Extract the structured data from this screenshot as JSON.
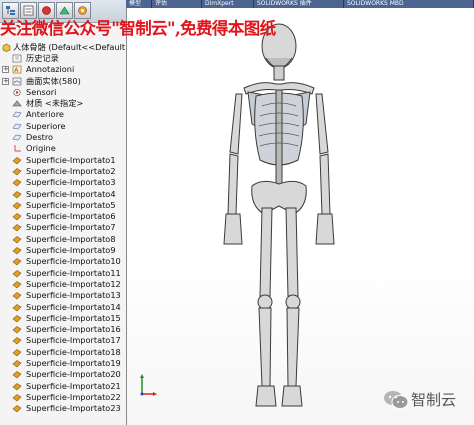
{
  "watermark": "关注微信公众号\"智制云\",免费得本图纸",
  "top_tabs": [
    "模型",
    "评估",
    "DimXpert",
    "SOLIDWORKS 插件",
    "SOLIDWORKS MBD"
  ],
  "tree": {
    "root": "人体骨骼  (Default<<Default",
    "items": [
      {
        "label": "历史记录",
        "icon": "history-icon",
        "expand": false
      },
      {
        "label": "Annotazioni",
        "icon": "annotation-icon",
        "expand": true
      },
      {
        "label": "曲面实体(580)",
        "icon": "surface-bodies-icon",
        "expand": true
      },
      {
        "label": "Sensori",
        "icon": "sensor-icon",
        "expand": false
      },
      {
        "label": "材质 <未指定>",
        "icon": "material-icon",
        "expand": false
      },
      {
        "label": "Anteriore",
        "icon": "plane-icon",
        "expand": false
      },
      {
        "label": "Superiore",
        "icon": "plane-icon",
        "expand": false
      },
      {
        "label": "Destro",
        "icon": "plane-icon",
        "expand": false
      },
      {
        "label": "Origine",
        "icon": "origin-icon",
        "expand": false
      },
      {
        "label": "Superficie-Importato1",
        "icon": "surface-icon",
        "expand": false
      },
      {
        "label": "Superficie-Importato2",
        "icon": "surface-icon",
        "expand": false
      },
      {
        "label": "Superficie-Importato3",
        "icon": "surface-icon",
        "expand": false
      },
      {
        "label": "Superficie-Importato4",
        "icon": "surface-icon",
        "expand": false
      },
      {
        "label": "Superficie-Importato5",
        "icon": "surface-icon",
        "expand": false
      },
      {
        "label": "Superficie-Importato6",
        "icon": "surface-icon",
        "expand": false
      },
      {
        "label": "Superficie-Importato7",
        "icon": "surface-icon",
        "expand": false
      },
      {
        "label": "Superficie-Importato8",
        "icon": "surface-icon",
        "expand": false
      },
      {
        "label": "Superficie-Importato9",
        "icon": "surface-icon",
        "expand": false
      },
      {
        "label": "Superficie-Importato10",
        "icon": "surface-icon",
        "expand": false
      },
      {
        "label": "Superficie-Importato11",
        "icon": "surface-icon",
        "expand": false
      },
      {
        "label": "Superficie-Importato12",
        "icon": "surface-icon",
        "expand": false
      },
      {
        "label": "Superficie-Importato13",
        "icon": "surface-icon",
        "expand": false
      },
      {
        "label": "Superficie-Importato14",
        "icon": "surface-icon",
        "expand": false
      },
      {
        "label": "Superficie-Importato15",
        "icon": "surface-icon",
        "expand": false
      },
      {
        "label": "Superficie-Importato16",
        "icon": "surface-icon",
        "expand": false
      },
      {
        "label": "Superficie-Importato17",
        "icon": "surface-icon",
        "expand": false
      },
      {
        "label": "Superficie-Importato18",
        "icon": "surface-icon",
        "expand": false
      },
      {
        "label": "Superficie-Importato19",
        "icon": "surface-icon",
        "expand": false
      },
      {
        "label": "Superficie-Importato20",
        "icon": "surface-icon",
        "expand": false
      },
      {
        "label": "Superficie-Importato21",
        "icon": "surface-icon",
        "expand": false
      },
      {
        "label": "Superficie-Importato22",
        "icon": "surface-icon",
        "expand": false
      },
      {
        "label": "Superficie-Importato23",
        "icon": "surface-icon",
        "expand": false
      }
    ]
  },
  "viewport": {
    "model": "human-skeleton-model"
  },
  "wechat_label": "智制云",
  "colors": {
    "watermark": "#e2141b",
    "surface_icon": "#e0a020",
    "tree_bg": "#f4f4f4"
  }
}
